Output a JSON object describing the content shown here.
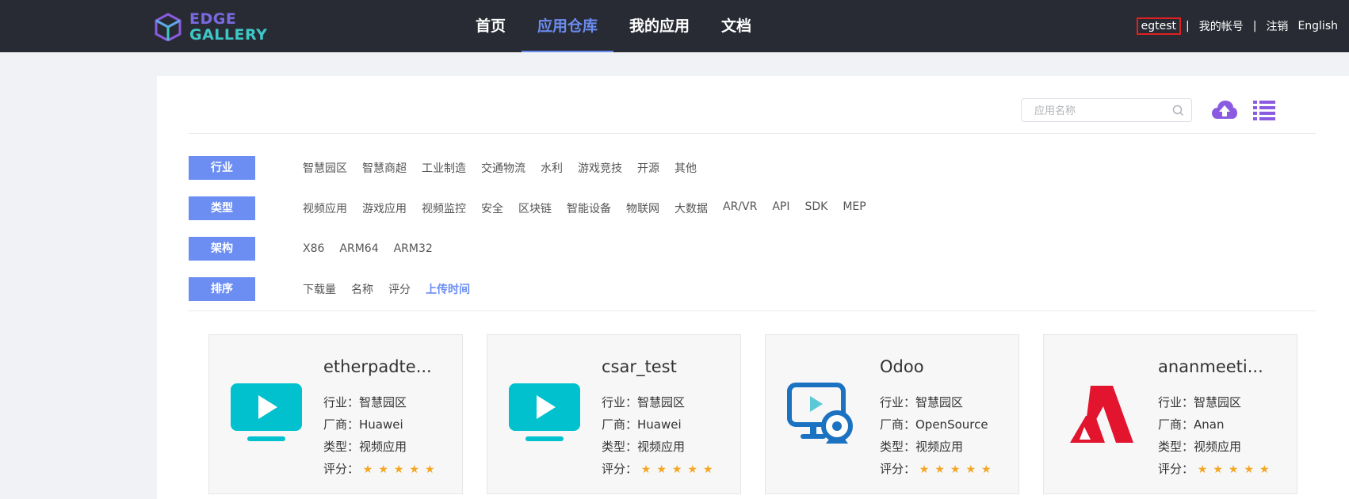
{
  "brand": {
    "line1": "EDGE",
    "line2": "GALLERY"
  },
  "nav": [
    {
      "label": "首页",
      "active": false
    },
    {
      "label": "应用仓库",
      "active": true
    },
    {
      "label": "我的应用",
      "active": false
    },
    {
      "label": "文档",
      "active": false
    }
  ],
  "user": {
    "name": "egtest",
    "separator": "|",
    "account": "我的帐号",
    "logout": "注销",
    "language": "English"
  },
  "search": {
    "placeholder": "应用名称",
    "value": ""
  },
  "filters": [
    {
      "label": "行业",
      "options": [
        "智慧园区",
        "智慧商超",
        "工业制造",
        "交通物流",
        "水利",
        "游戏竞技",
        "开源",
        "其他"
      ]
    },
    {
      "label": "类型",
      "options": [
        "视频应用",
        "游戏应用",
        "视频监控",
        "安全",
        "区块链",
        "智能设备",
        "物联网",
        "大数据",
        "AR/VR",
        "API",
        "SDK",
        "MEP"
      ]
    },
    {
      "label": "架构",
      "options": [
        "X86",
        "ARM64",
        "ARM32"
      ]
    },
    {
      "label": "排序",
      "options": [
        "下载量",
        "名称",
        "评分",
        "上传时间"
      ],
      "active": "上传时间"
    }
  ],
  "cards": [
    {
      "name": "etherpadte...",
      "industry": "行业：智慧园区",
      "vendor": "厂商：Huawei",
      "type": "类型：视频应用",
      "rating_label": "评分：",
      "rating": 5,
      "icon": "video-play-icon"
    },
    {
      "name": "csar_test",
      "industry": "行业：智慧园区",
      "vendor": "厂商：Huawei",
      "type": "类型：视频应用",
      "rating_label": "评分：",
      "rating": 5,
      "icon": "video-play-icon"
    },
    {
      "name": "Odoo",
      "industry": "行业：智慧园区",
      "vendor": "厂商：OpenSource",
      "type": "类型：视频应用",
      "rating_label": "评分：",
      "rating": 5,
      "icon": "monitor-webcam-icon"
    },
    {
      "name": "ananmeeti...",
      "industry": "行业：智慧园区",
      "vendor": "厂商：Anan",
      "type": "类型：视频应用",
      "rating_label": "评分：",
      "rating": 5,
      "icon": "anan-logo-icon"
    }
  ],
  "colors": {
    "header_bg": "#282b33",
    "accent": "#6c8ef3",
    "star": "#f5a623",
    "teal_icon": "#00c1cd",
    "red_logo": "#e3142e"
  }
}
